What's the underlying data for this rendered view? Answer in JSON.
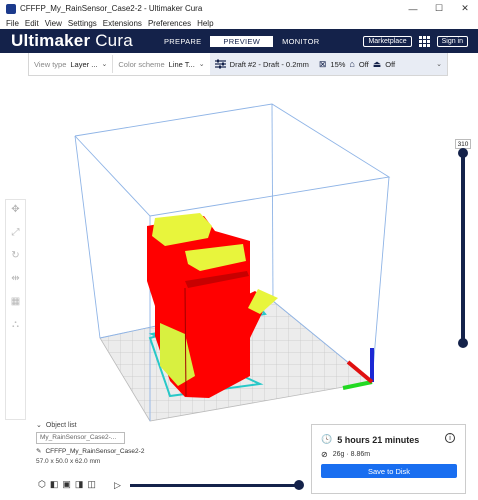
{
  "window": {
    "title": "CFFFP_My_RainSensor_Case2-2 - Ultimaker Cura",
    "minimize_glyph": "—",
    "maximize_glyph": "☐",
    "close_glyph": "✕"
  },
  "menu": [
    "File",
    "Edit",
    "View",
    "Settings",
    "Extensions",
    "Preferences",
    "Help"
  ],
  "header": {
    "brand_bold": "Ultimaker",
    "brand_light": " Cura",
    "tabs": [
      "PREPARE",
      "PREVIEW",
      "MONITOR"
    ],
    "active_tab": "PREVIEW",
    "marketplace_label": "Marketplace",
    "signin_label": "Sign in"
  },
  "toolbar": {
    "view_type_label": "View type",
    "view_type_value": "Layer ...",
    "color_scheme_label": "Color scheme",
    "color_scheme_value": "Line T...",
    "profile": "Draft #2 - Draft - 0.2mm",
    "infill": "15%",
    "support": "Off",
    "adhesion": "Off"
  },
  "layer_slider": {
    "max_layer": "310",
    "upper_fraction": 1.0,
    "lower_fraction": 0.0
  },
  "object_list": {
    "header": "Object list",
    "field_value": "My_RainSensor_Case2-...",
    "object_name": "CFFFP_My_RainSensor_Case2-2",
    "dimensions": "57.0 x 50.0 x 62.0 mm"
  },
  "simulation": {
    "progress_fraction": 1.0
  },
  "print_info": {
    "time": "5 hours 21 minutes",
    "material": "26g · 8.86m",
    "save_label": "Save to Disk"
  },
  "colors": {
    "header_bg": "#14224a",
    "model_red": "#ff0000",
    "model_yellow": "#e8f53c",
    "travel_cyan": "#28c8c8",
    "save_blue": "#196ef0"
  }
}
